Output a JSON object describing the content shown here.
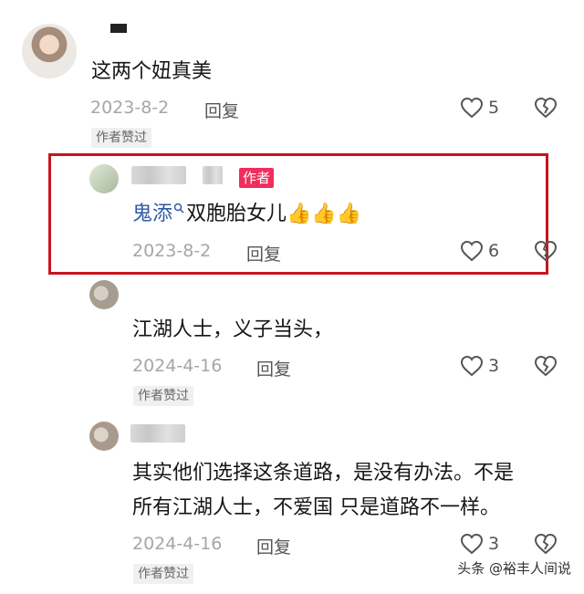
{
  "comments": [
    {
      "text": "这两个妞真美",
      "date": "2023-8-2",
      "reply_label": "回复",
      "likes": "5",
      "badge": "作者赞过"
    },
    {
      "author_tag": "作者",
      "mention": "鬼添",
      "text": "双胞胎女儿",
      "emojis": "👍👍👍",
      "date": "2023-8-2",
      "reply_label": "回复",
      "likes": "6"
    },
    {
      "text": "江湖人士，义子当头，",
      "date": "2024-4-16",
      "reply_label": "回复",
      "likes": "3",
      "badge": "作者赞过"
    },
    {
      "text_line1": "其实他们选择这条道路，是没有办法。不是",
      "text_line2": "所有江湖人士，不爱国 只是道路不一样。",
      "date": "2024-4-16",
      "reply_label": "回复",
      "likes": "3",
      "badge": "作者赞过"
    }
  ],
  "watermark": "头条 @裕丰人间说",
  "colors": {
    "highlight_border": "#c8141c",
    "author_tag": "#f02d5c",
    "mention": "#2e5aa6"
  },
  "icons": [
    "heart-outline-icon",
    "broken-heart-icon",
    "search-icon"
  ]
}
